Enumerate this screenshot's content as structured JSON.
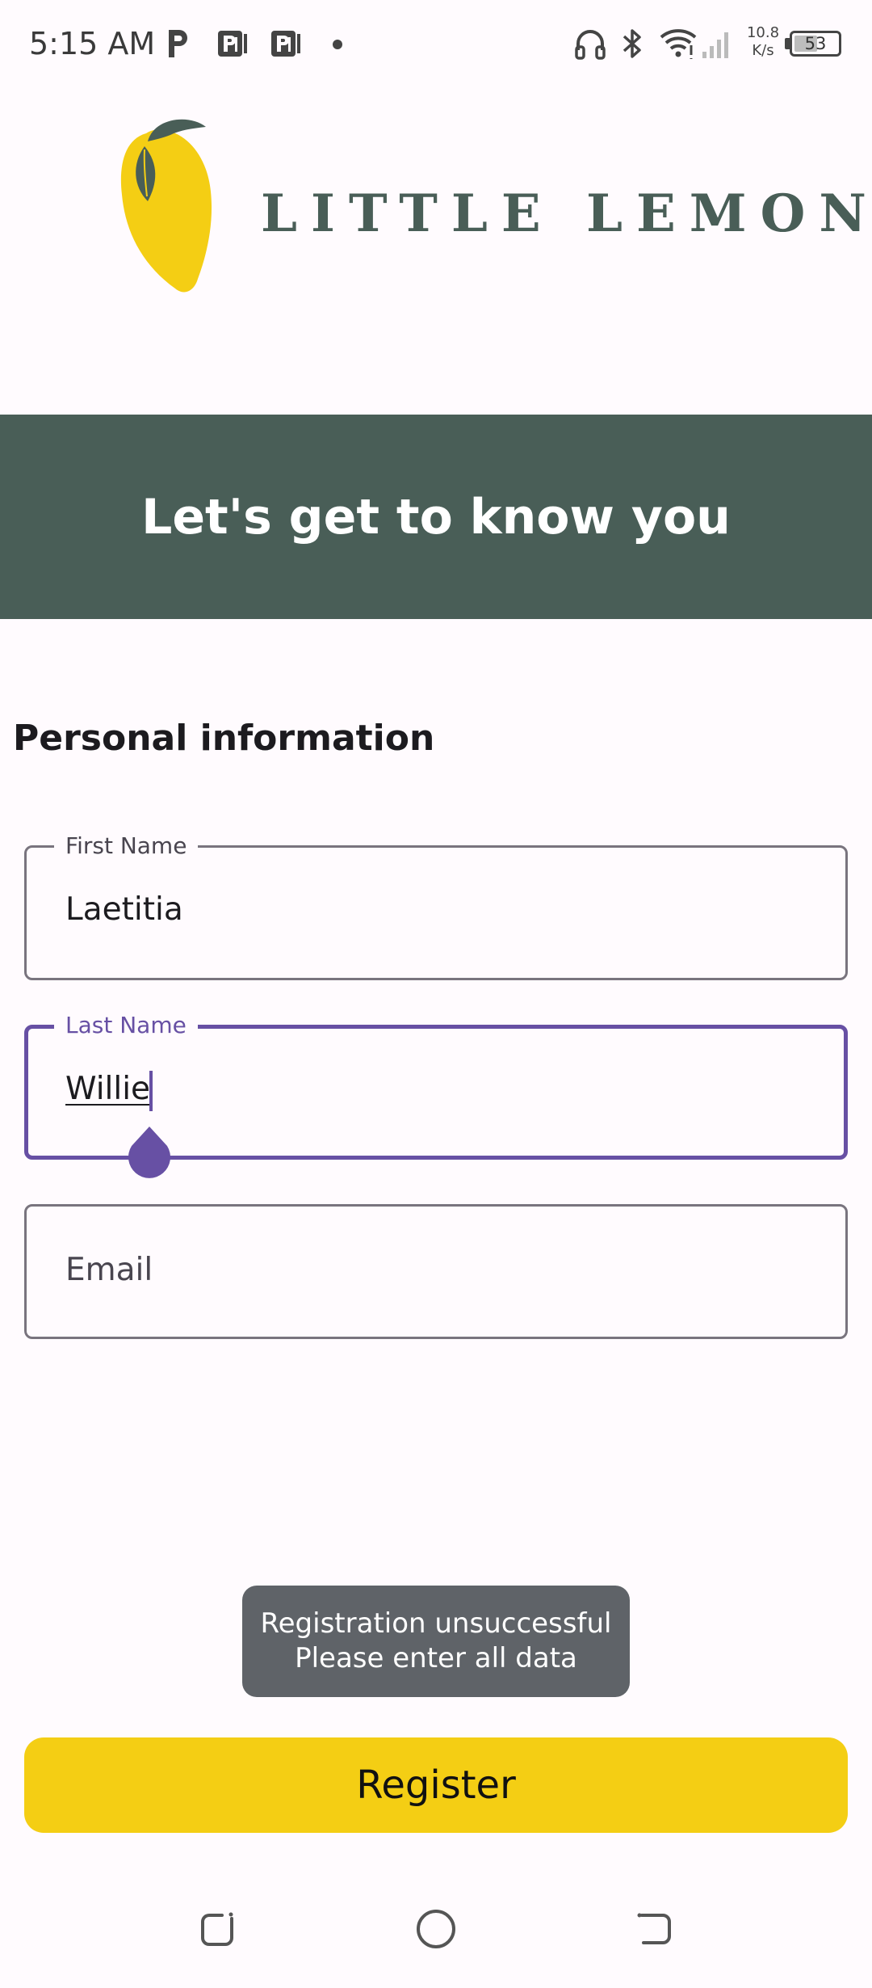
{
  "status_bar": {
    "time": "5:15 AM",
    "net_speed_value": "10.8",
    "net_speed_unit": "K/s",
    "battery": "53",
    "battery_level_percent": 53,
    "notification_icons": [
      "parking-icon",
      "app-icon",
      "app-icon"
    ],
    "system_icons": [
      "headphones-icon",
      "bluetooth-icon",
      "wifi-icon",
      "signal-icon"
    ]
  },
  "logo": {
    "text": "LITTLE LEMON",
    "colors": {
      "lemon": "#F4CE14",
      "leaf": "#495E57"
    }
  },
  "hero": {
    "title": "Let's get to know you",
    "background": "#495E57"
  },
  "form": {
    "section_title": "Personal information",
    "first_name": {
      "label": "First Name",
      "value": "Laetitia"
    },
    "last_name": {
      "label": "Last Name",
      "value": "Willie",
      "focused": true
    },
    "email": {
      "placeholder": "Email",
      "value": ""
    },
    "focus_color": "#6750A4"
  },
  "toast": {
    "line1": "Registration unsuccessful",
    "line2": "Please enter all data"
  },
  "register_button": {
    "label": "Register",
    "color": "#F4CE14"
  },
  "nav_bar": {
    "buttons": [
      "recents-icon",
      "home-icon",
      "back-icon"
    ]
  }
}
